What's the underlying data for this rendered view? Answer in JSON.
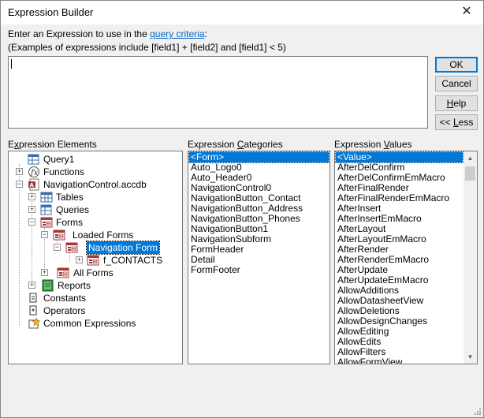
{
  "window": {
    "title": "Expression Builder",
    "close_glyph": "✕"
  },
  "intro": {
    "prefix": "Enter an Expression to use in the ",
    "link": "query criteria",
    "suffix": ":",
    "examples": "(Examples of expressions include [field1] + [field2] and [field1] < 5)"
  },
  "expression": {
    "value": ""
  },
  "buttons": {
    "ok": "OK",
    "cancel": "Cancel",
    "help_u": "H",
    "help_rest": "elp",
    "less_pre": "<< ",
    "less_u": "L",
    "less_rest": "ess"
  },
  "elements_panel": {
    "label_pre": "E",
    "label_u": "x",
    "label_post": "pression Elements",
    "items": [
      {
        "label": "Query1",
        "icon": "query-icon"
      },
      {
        "label": "Functions",
        "icon": "function-icon"
      },
      {
        "label": "NavigationControl.accdb",
        "icon": "database-icon"
      },
      {
        "label": "Tables",
        "icon": "table-icon"
      },
      {
        "label": "Queries",
        "icon": "query-icon"
      },
      {
        "label": "Forms",
        "icon": "form-icon"
      },
      {
        "label": "Loaded Forms",
        "icon": "form-icon"
      },
      {
        "label": "Navigation Form",
        "icon": "form-icon",
        "selected": true
      },
      {
        "label": "f_CONTACTS",
        "icon": "form-icon"
      },
      {
        "label": "All Forms",
        "icon": "form-icon"
      },
      {
        "label": "Reports",
        "icon": "report-icon"
      },
      {
        "label": "Constants",
        "icon": "constant-icon"
      },
      {
        "label": "Operators",
        "icon": "operator-icon"
      },
      {
        "label": "Common Expressions",
        "icon": "common-expression-icon"
      }
    ]
  },
  "categories_panel": {
    "label_pre": "Expression ",
    "label_u": "C",
    "label_post": "ategories",
    "items": [
      "<Form>",
      "Auto_Logo0",
      "Auto_Header0",
      "NavigationControl0",
      "NavigationButton_Contact",
      "NavigationButton_Address",
      "NavigationButton_Phones",
      "NavigationButton1",
      "NavigationSubform",
      "FormHeader",
      "Detail",
      "FormFooter"
    ]
  },
  "values_panel": {
    "label_pre": "Expression ",
    "label_u": "V",
    "label_post": "alues",
    "items": [
      "<Value>",
      "AfterDelConfirm",
      "AfterDelConfirmEmMacro",
      "AfterFinalRender",
      "AfterFinalRenderEmMacro",
      "AfterInsert",
      "AfterInsertEmMacro",
      "AfterLayout",
      "AfterLayoutEmMacro",
      "AfterRender",
      "AfterRenderEmMacro",
      "AfterUpdate",
      "AfterUpdateEmMacro",
      "AllowAdditions",
      "AllowDatasheetView",
      "AllowDeletions",
      "AllowDesignChanges",
      "AllowEditing",
      "AllowEdits",
      "AllowFilters",
      "AllowFormView"
    ]
  },
  "colors": {
    "selection": "#0078d7",
    "link": "#0563c1",
    "dialog_bg": "#f0f0f0"
  }
}
